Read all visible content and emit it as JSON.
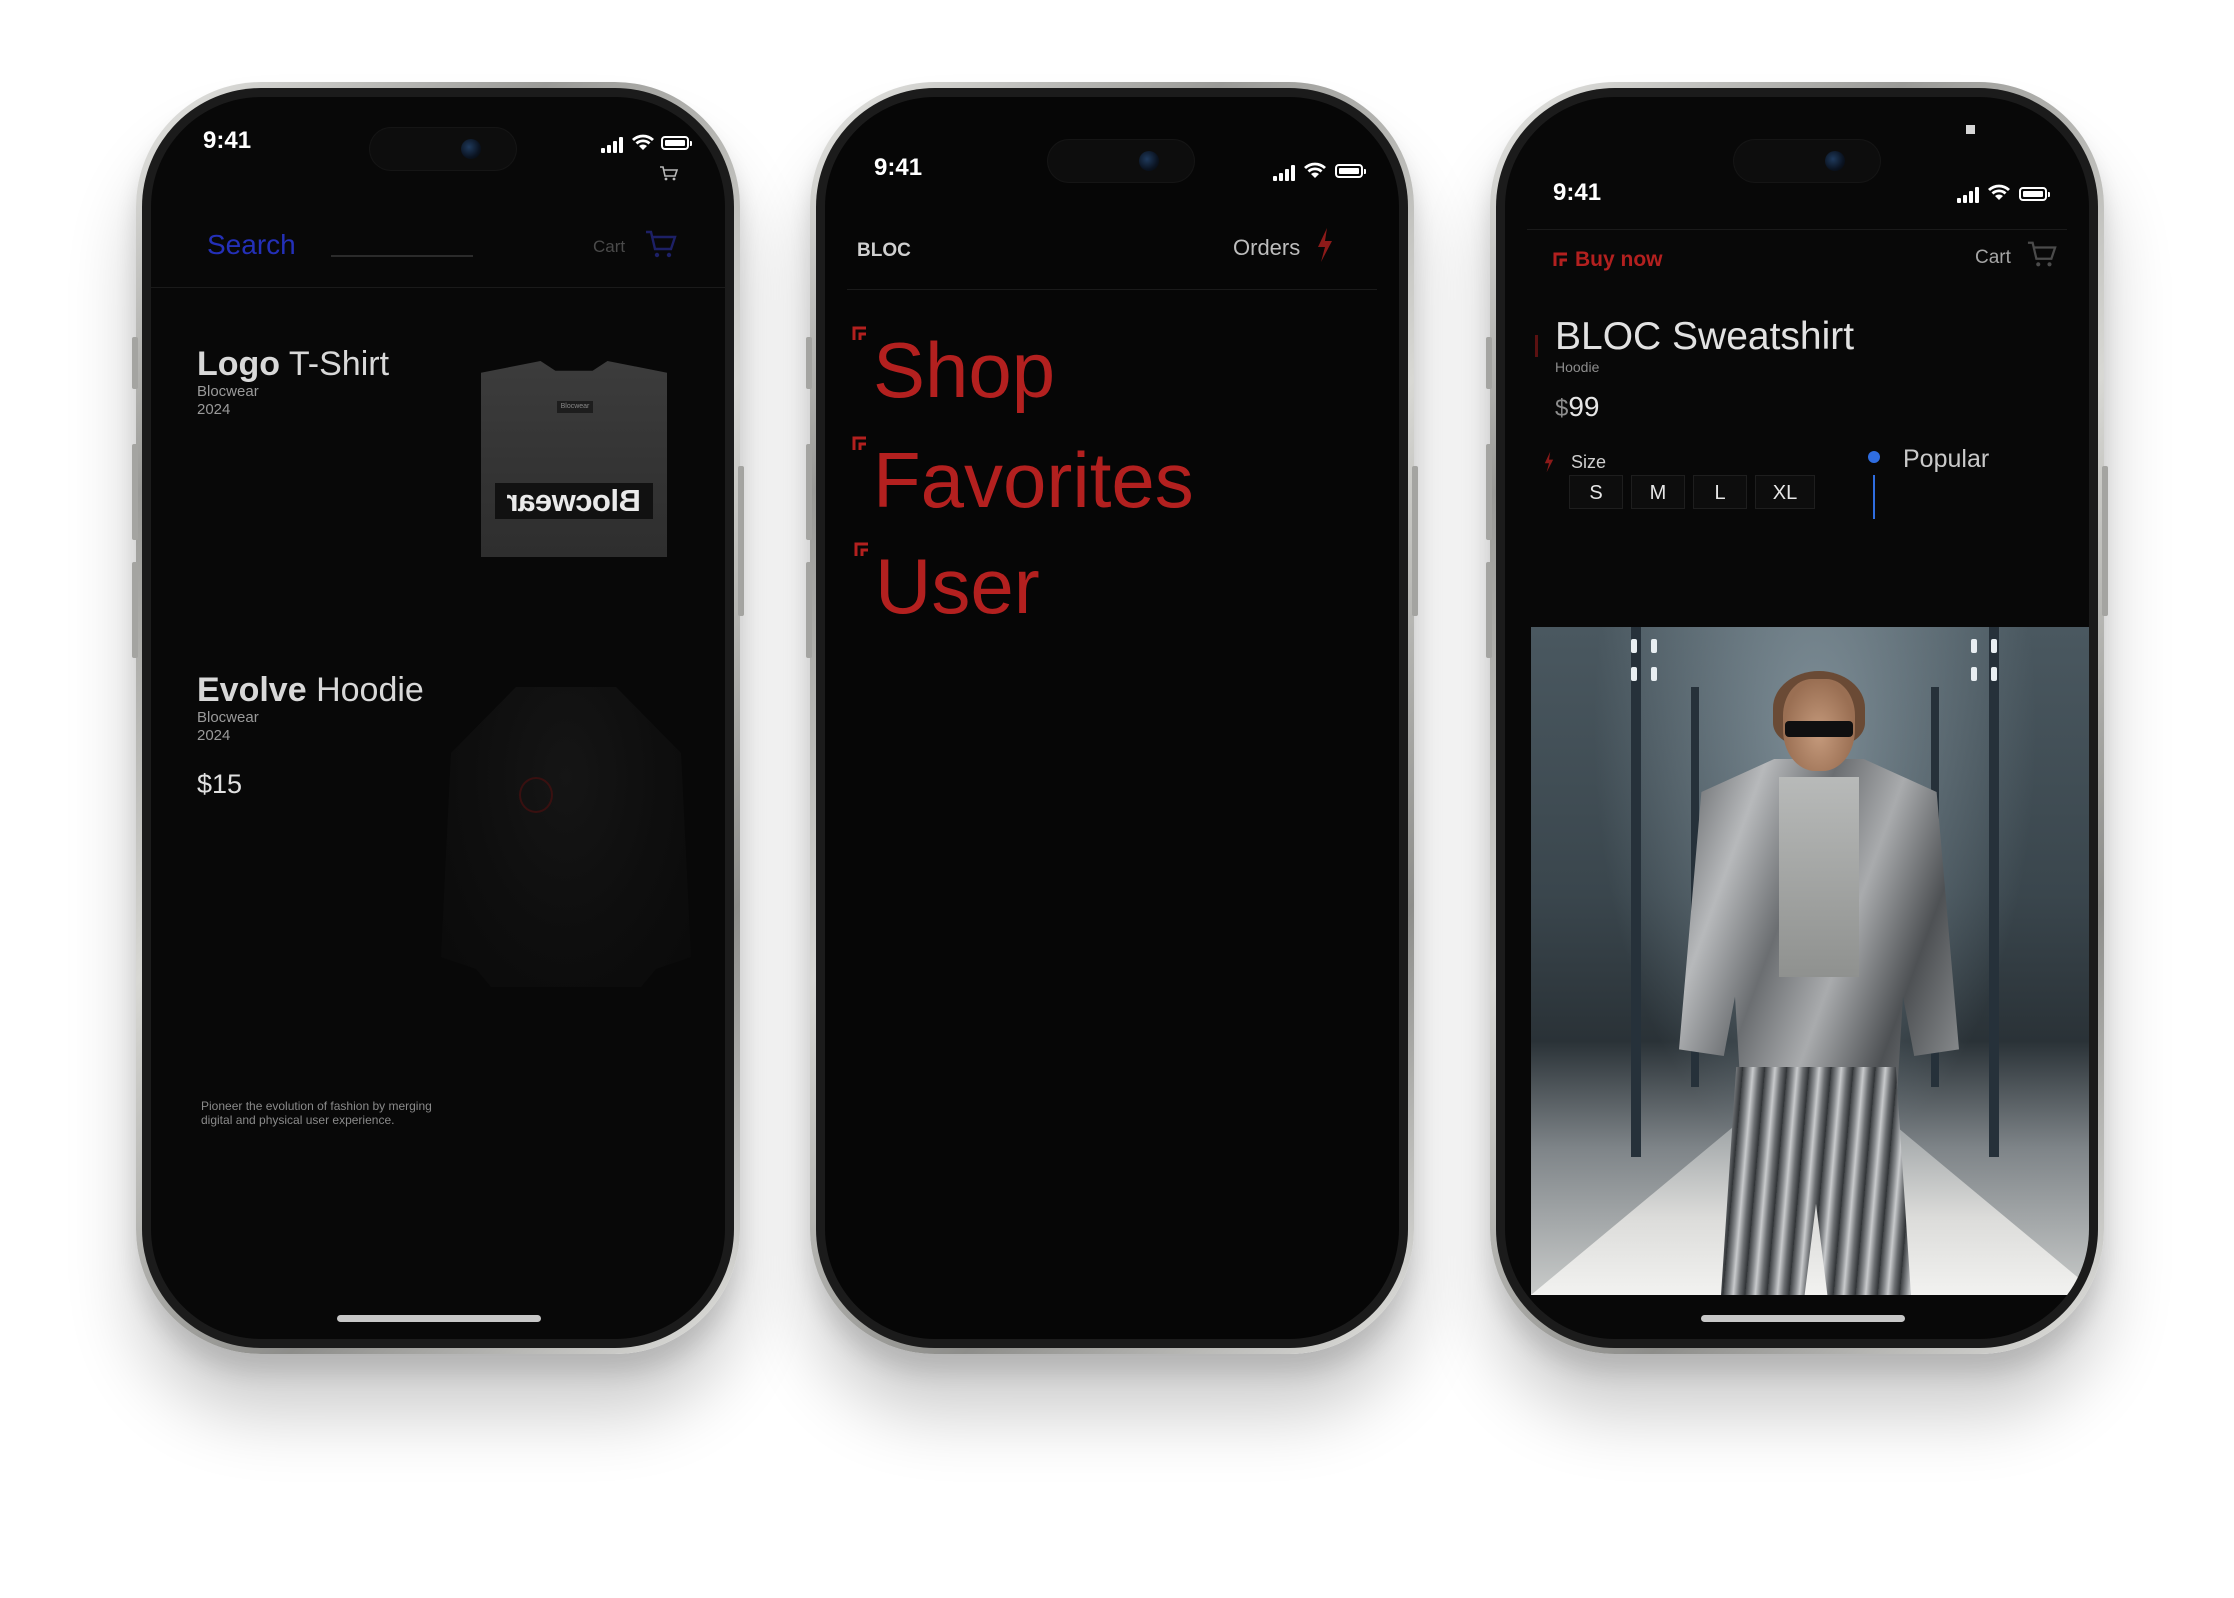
{
  "status_time": "9:41",
  "phone1": {
    "search_label": "Search",
    "cart_label": "Cart",
    "products": [
      {
        "name_bold": "Logo",
        "name_rest": " T-Shirt",
        "brand": "Blocwear",
        "year": "2024",
        "print_text": "Blocwear",
        "tag_text": "Blocwear"
      },
      {
        "name_bold": "Evolve",
        "name_rest": " Hoodie",
        "brand": "Blocwear",
        "year": "2024",
        "price": "$15"
      }
    ],
    "footer_line1": "Pioneer the evolution of fashion by merging",
    "footer_line2": "digital and physical user experience."
  },
  "phone2": {
    "brand": "BLOC",
    "orders_label": "Orders",
    "menu": [
      {
        "label": "Shop"
      },
      {
        "label": "Favorites"
      },
      {
        "label": "User"
      }
    ]
  },
  "phone3": {
    "buy_now_label": "Buy now",
    "cart_label": "Cart",
    "product_name": "BLOC Sweatshirt",
    "product_type": "Hoodie",
    "price_currency": "$",
    "price_value": "99",
    "size_label": "Size",
    "sizes": [
      "S",
      "M",
      "L",
      "XL"
    ],
    "popular_label": "Popular"
  },
  "colors": {
    "accent_red": "#b3201f",
    "accent_blue": "#2430b8",
    "popular_blue": "#2f6de0",
    "screen_bg": "#080808"
  },
  "icons": [
    "cart-icon",
    "bolt-icon",
    "corner-bracket-icon",
    "signal-icon",
    "wifi-icon",
    "battery-icon"
  ]
}
